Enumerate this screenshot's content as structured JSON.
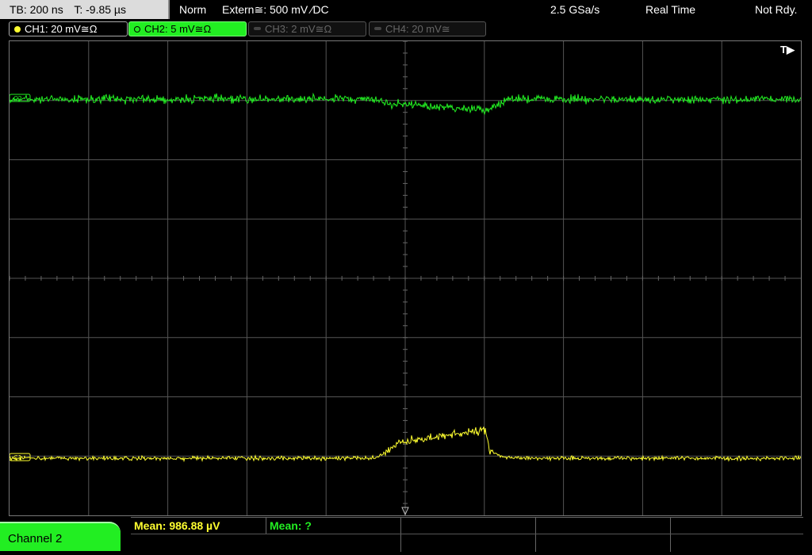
{
  "timebase": {
    "tb": "TB: 200 ns",
    "trigger_time": "T: -9.85 µs"
  },
  "status": {
    "mode": "Norm",
    "trigger": "Extern≅: 500 mV ⁄DC",
    "sample_rate": "2.5 GSa/s",
    "acquisition": "Real Time",
    "state": "Not Rdy."
  },
  "channels": [
    {
      "label": "CH1: 20 mV≅Ω",
      "state": "active",
      "color": "#ffff30"
    },
    {
      "label": "CH2: 5 mV≅Ω",
      "state": "selected",
      "color": "#22ee22"
    },
    {
      "label": "CH3: 2 mV≅Ω",
      "state": "off",
      "color": "#666666"
    },
    {
      "label": "CH4: 20 mV≅",
      "state": "off",
      "color": "#666666"
    }
  ],
  "screen": {
    "trigger_marker": "T▶",
    "grid_divisions": {
      "horizontal": 10,
      "vertical": 8
    },
    "markers": {
      "ch2": "C2",
      "ch1": "C1"
    }
  },
  "softkey": {
    "label": "Channel 2"
  },
  "measurements": [
    {
      "text": "Mean: 986.88 µV",
      "color": "#ffff30"
    },
    {
      "text": "Mean: ?",
      "color": "#22ee22"
    }
  ],
  "colors": {
    "ch1": "#ffff30",
    "ch2": "#22ee22",
    "grid": "#555555"
  }
}
